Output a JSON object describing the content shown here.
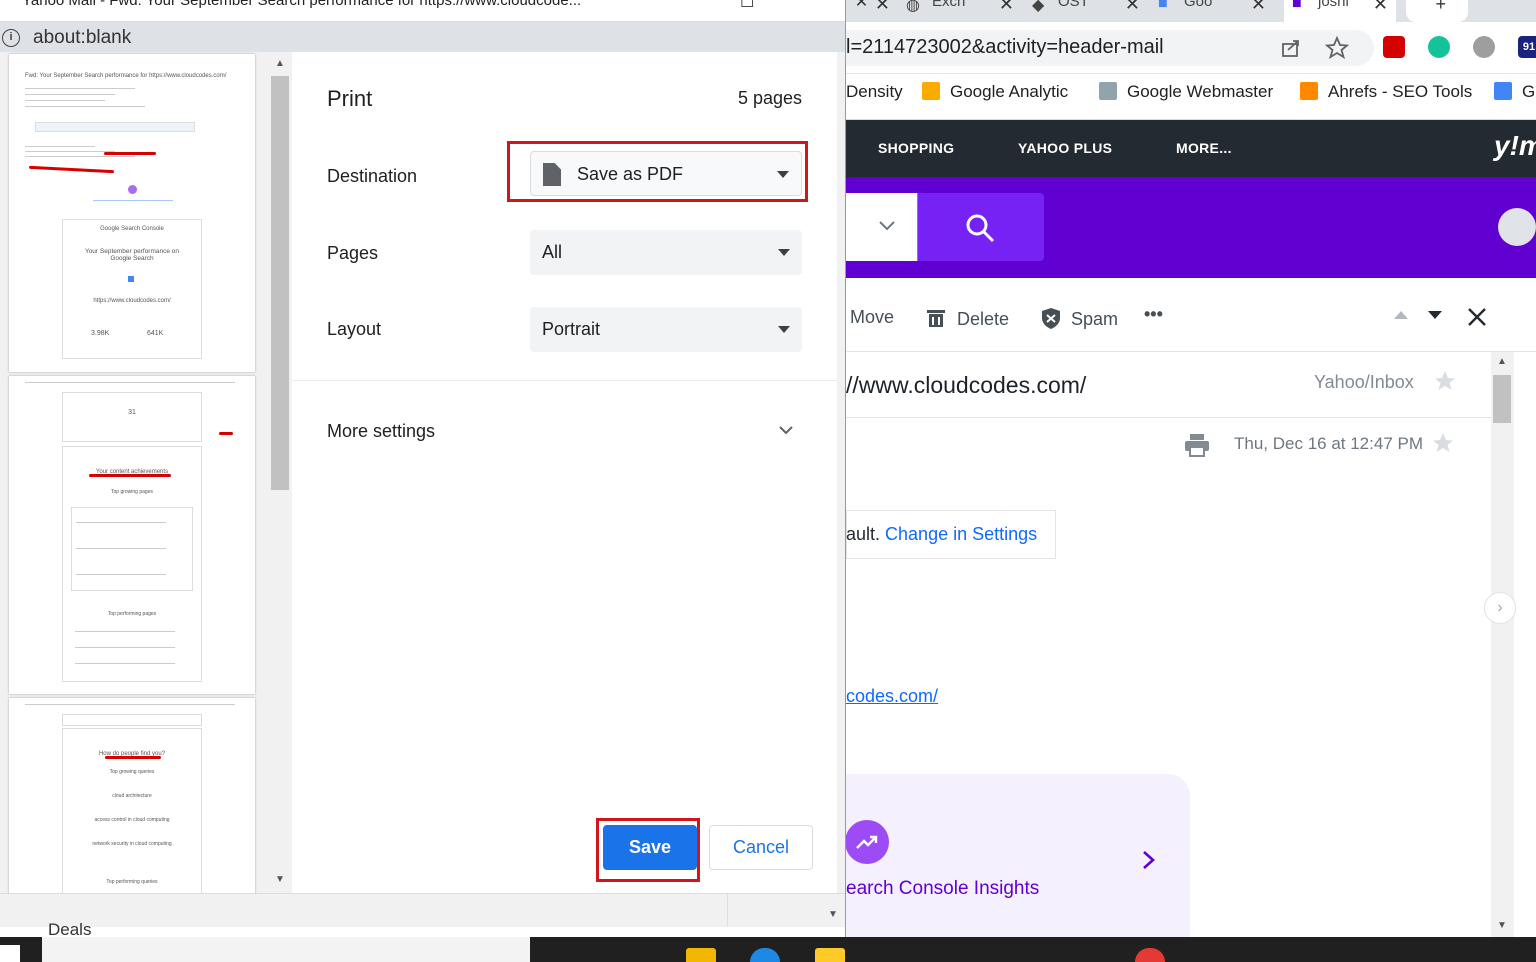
{
  "print_window": {
    "title": "Yahoo Mail - Fwd: Your September Search performance for https://www.cloudcode...",
    "window_buttons": "☐ ✕",
    "tab_url": "about:blank"
  },
  "print_dialog": {
    "title": "Print",
    "page_count": "5 pages",
    "destination_label": "Destination",
    "destination_value": "Save as PDF",
    "pages_label": "Pages",
    "pages_value": "All",
    "layout_label": "Layout",
    "layout_value": "Portrait",
    "more_settings_label": "More settings",
    "save_label": "Save",
    "cancel_label": "Cancel",
    "highlight_color": "#d0161c",
    "accent_color": "#1a73e8"
  },
  "preview": {
    "page1": {
      "subject": "Fwd: Your September Search performance for https://www.cloudcodes.com/",
      "brand": "Google Search Console",
      "heading": "Your September performance on Google Search",
      "site": "https://www.cloudcodes.com/",
      "clicks": "3.98K",
      "impressions": "641K"
    },
    "page2": {
      "big_number": "31",
      "section": "Your content achievements",
      "sub": "Top growing pages",
      "sub2": "Top performing pages"
    },
    "page3": {
      "section": "How do people find you?",
      "sub": "Top growing queries",
      "queries": [
        "cloud architecture",
        "access control in cloud computing",
        "network security in cloud computing"
      ],
      "sub2": "Top performing queries"
    }
  },
  "background_browser": {
    "tabs": [
      "Exch",
      "OST",
      "Goo",
      "joshi"
    ],
    "url_fragment": "l=2114723002&activity=header-mail",
    "bookmarks": [
      "Density",
      "Google Analytic",
      "Google Webmaster",
      "Ahrefs - SEO Tools",
      "G"
    ],
    "nav": [
      "SHOPPING",
      "YAHOO PLUS",
      "MORE..."
    ],
    "logo": "y!m",
    "toolbar": {
      "move": "Move",
      "delete": "Delete",
      "spam": "Spam",
      "more": "•••"
    },
    "subject_fragment": "//www.cloudcodes.com/",
    "folder": "Yahoo/Inbox",
    "date": "Thu, Dec 16 at 12:47 PM",
    "settings_prefix": "ault. ",
    "settings_link": "Change in Settings",
    "link_fragment": "codes.com/",
    "insights_text": "earch Console Insights",
    "deals": "Deals",
    "ext_badge": "91"
  },
  "icons": [
    "info-icon",
    "document-icon",
    "caret-down-icon",
    "chevron-down-icon",
    "search-icon",
    "delete-icon",
    "spam-shield-icon",
    "print-icon",
    "star-icon",
    "close-icon",
    "up-arrow-icon",
    "down-arrow-icon",
    "trend-icon",
    "chevron-right-icon"
  ]
}
